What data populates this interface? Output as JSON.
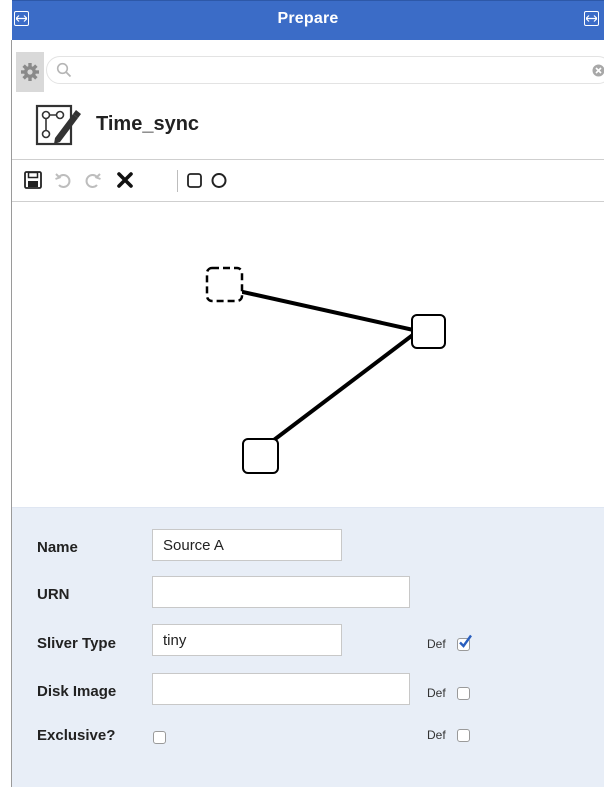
{
  "window": {
    "title": "Prepare"
  },
  "search": {
    "placeholder": "",
    "value": ""
  },
  "header": {
    "name": "Time_sync"
  },
  "toolbar": {
    "buttons": [
      "save",
      "undo",
      "redo",
      "delete",
      "add-square-node",
      "add-circle-node"
    ]
  },
  "topology": {
    "nodes": [
      {
        "id": "node-1",
        "selected": true
      },
      {
        "id": "node-2",
        "selected": false
      },
      {
        "id": "node-3",
        "selected": false
      }
    ],
    "links": [
      {
        "from": "node-1",
        "to": "node-2"
      },
      {
        "from": "node-2",
        "to": "node-3"
      }
    ]
  },
  "form": {
    "name_label": "Name",
    "name_value": "Source A",
    "urn_label": "URN",
    "urn_value": "",
    "sliver_type_label": "Sliver Type",
    "sliver_type_value": "tiny",
    "disk_image_label": "Disk Image",
    "disk_image_value": "",
    "exclusive_label": "Exclusive?",
    "def_label": "Def",
    "sliver_type_def_checked": true,
    "disk_image_def_checked": false,
    "exclusive_checked": false,
    "exclusive_def_checked": false
  },
  "colors": {
    "titlebar": "#3b6cc7",
    "form_bg": "#e8eef7",
    "check_blue": "#2a5fbf"
  }
}
